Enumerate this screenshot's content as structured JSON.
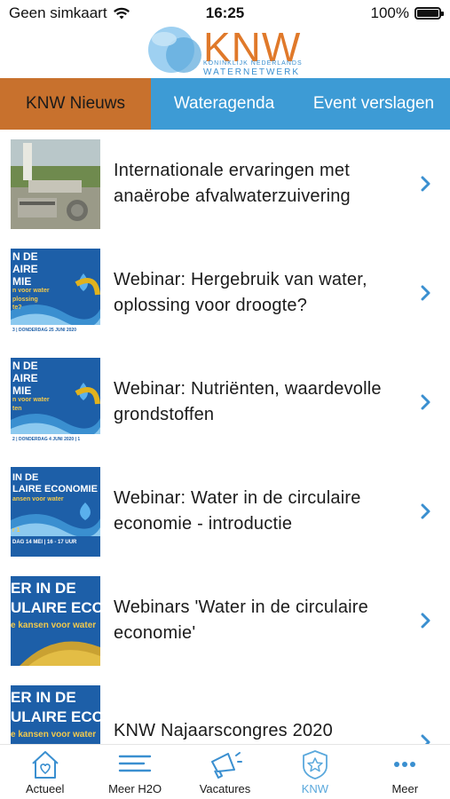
{
  "status": {
    "carrier": "Geen simkaart",
    "time": "16:25",
    "battery": "100%"
  },
  "header": {
    "logo_text": "KNW",
    "logo_sub1": "KONINKLIJK NEDERLANDS",
    "logo_sub2": "WATERNETWERK"
  },
  "tabs": [
    {
      "label": "KNW Nieuws",
      "active": true
    },
    {
      "label": "Wateragenda",
      "active": false
    },
    {
      "label": "Event verslagen",
      "active": false
    }
  ],
  "items": [
    {
      "title": "Internationale ervaringen met anaërobe afvalwaterzuivering",
      "thumb": "photo"
    },
    {
      "title": "Webinar: Hergebruik van water, oplossing voor droogte?",
      "thumb_lines": [
        "N DE",
        "AIRE",
        "MIE",
        "n voor water",
        "plossing",
        "te?"
      ],
      "thumb_footer": "3 | DONDERDAG 25 JUNI 2020"
    },
    {
      "title": "Webinar: Nutriënten, waardevolle grondstoffen",
      "thumb_lines": [
        "N DE",
        "AIRE",
        "MIE",
        "n voor water",
        "ten"
      ],
      "thumb_footer": "2 | DONDERDAG 4 JUNI 2020 | 1"
    },
    {
      "title": "Webinar: Water in de circulaire economie - introductie",
      "thumb_lines": [
        "IN DE",
        "LAIRE ECONOMIE",
        "ansen voor water",
        "r 1"
      ],
      "thumb_footer": "DAG 14 MEI | 16 - 17 UUR"
    },
    {
      "title": "Webinars 'Water in de circulaire economie'",
      "thumb_lines": [
        "ER IN DE",
        "ULAIRE ECON",
        "e kansen voor water"
      ]
    },
    {
      "title": "KNW Najaarscongres 2020",
      "thumb_lines": [
        "ER IN DE",
        "ULAIRE ECON",
        "e kansen voor water"
      ]
    }
  ],
  "tabbar": [
    {
      "label": "Actueel",
      "icon": "house-heart-icon",
      "selected": false
    },
    {
      "label": "Meer H2O",
      "icon": "lines-icon",
      "selected": false
    },
    {
      "label": "Vacatures",
      "icon": "megaphone-icon",
      "selected": false
    },
    {
      "label": "KNW",
      "icon": "badge-star-icon",
      "selected": true
    },
    {
      "label": "Meer",
      "icon": "ellipsis-icon",
      "selected": false
    }
  ],
  "colors": {
    "tab_bg": "#3d9bd5",
    "tab_active": "#c8712d",
    "accent_blue": "#3a8fd0",
    "logo_orange": "#e0792a",
    "chevron": "#3a8fd0",
    "thumb_blue": "#1d5fa8"
  }
}
